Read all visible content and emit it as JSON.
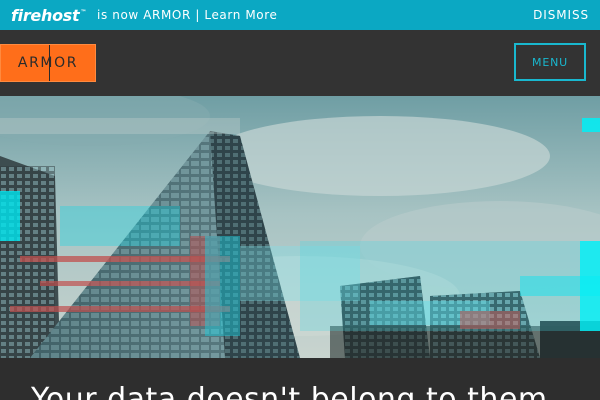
{
  "announcement": {
    "brand": "firehost",
    "trademark": "™",
    "message": "is now ARMOR | Learn More",
    "dismiss_label": "DISMISS"
  },
  "header": {
    "logo_text": "ARMOR",
    "menu_label": "MENU"
  },
  "hero": {
    "image": "city-skyscrapers-glitch-image",
    "headline": "Your data doesn't belong to them"
  },
  "colors": {
    "announcement_bg": "#0ba8c3",
    "header_bg": "#333333",
    "logo_orange": "#ff6e1a",
    "menu_accent": "#19b8cf"
  }
}
